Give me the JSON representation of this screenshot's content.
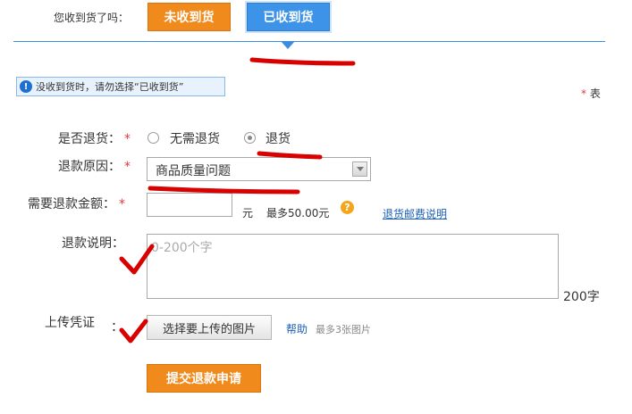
{
  "received": {
    "question": "您收到货了吗：",
    "not_received": "未收到货",
    "received": "已收到货"
  },
  "notice": {
    "icon": "!",
    "text": "没收到货时，请勿选择“已收到货”"
  },
  "required_note": {
    "star": "*",
    "text": "表"
  },
  "form": {
    "return": {
      "label": "是否退货：",
      "star": "*",
      "options": [
        "无需退货",
        "退货"
      ],
      "selected": "退货"
    },
    "reason": {
      "label": "退款原因：",
      "star": "*",
      "value": "商品质量问题"
    },
    "amount": {
      "label": "需要退款金额：",
      "star": "*",
      "value": "",
      "unit": "元",
      "max": "最多50.00元",
      "help_icon": "?",
      "link": "退货邮费说明"
    },
    "description": {
      "label": "退款说明：",
      "placeholder": "0-200个字",
      "counter": "200字"
    },
    "upload": {
      "label": "上传凭证",
      "colon": "：",
      "button": "选择要上传的图片",
      "help": "帮助",
      "limit": "最多3张图片"
    },
    "submit": "提交退款申请"
  },
  "colors": {
    "orange": "#f08a1d",
    "blue": "#3d93e8",
    "annotation_red": "#d90000"
  }
}
